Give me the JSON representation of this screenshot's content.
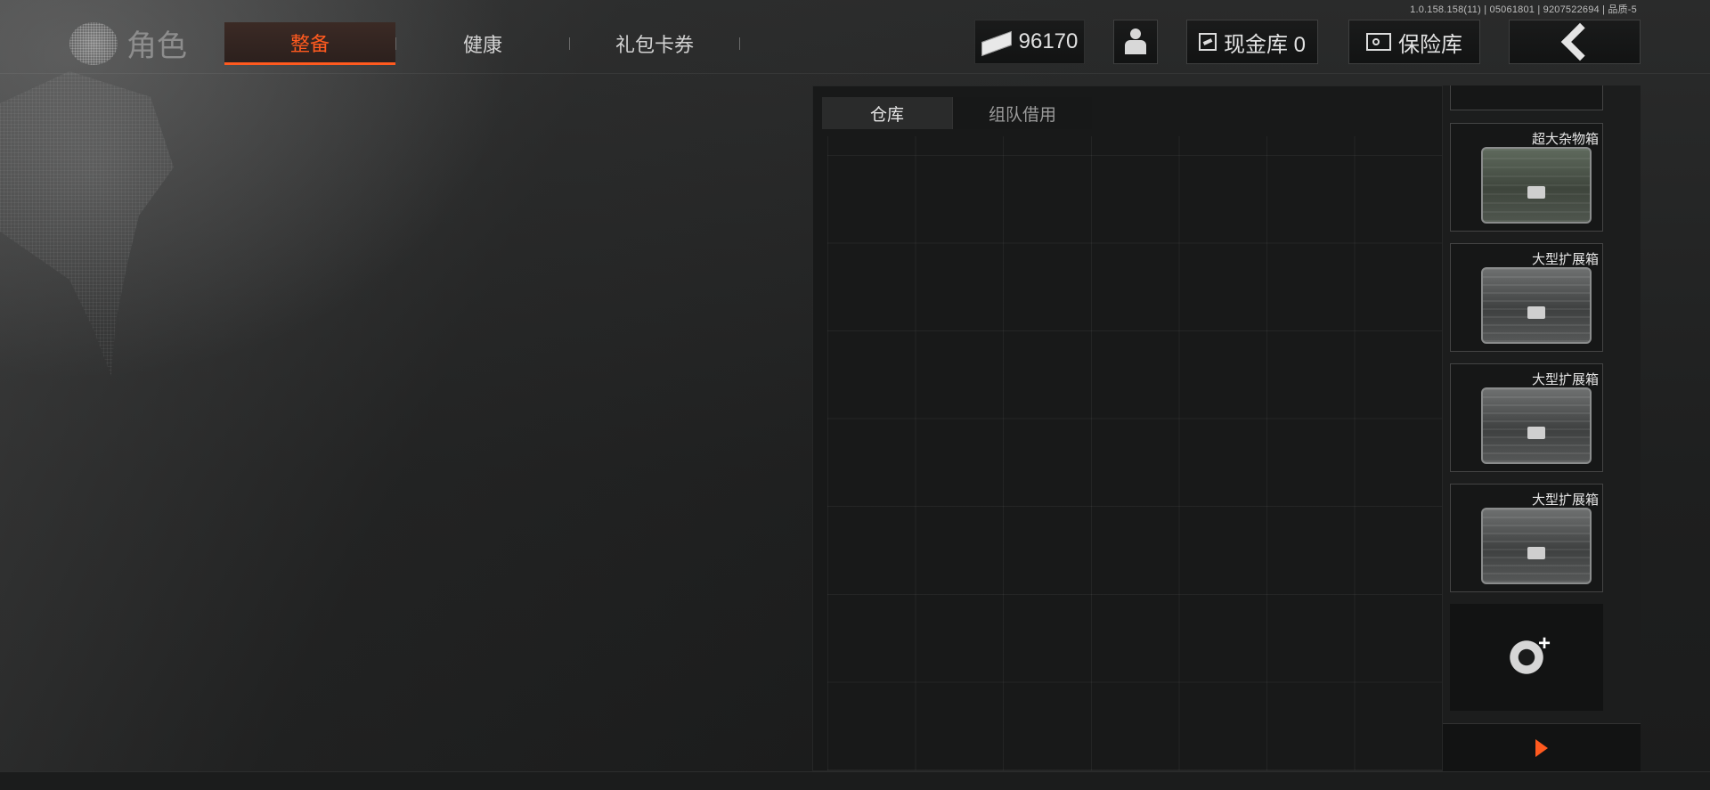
{
  "version": "1.0.158.158(11) | 05061801 | 9207522694 | 品质-5",
  "header": {
    "role_label": "角色",
    "tabs": [
      {
        "label": "整备",
        "active": true
      },
      {
        "label": "健康",
        "active": false
      },
      {
        "label": "礼包卡券",
        "active": false
      }
    ],
    "money": "96170",
    "cash_vault": "现金库 0",
    "vault": "保险库",
    "icons": [
      "money-icon",
      "agent-icon",
      "cash-box-icon",
      "vault-icon",
      "back-chevron-icon"
    ]
  },
  "warehouse": {
    "tabs": [
      {
        "label": "仓库",
        "active": true
      },
      {
        "label": "组队借用",
        "active": false
      }
    ],
    "grid": {
      "columns": 7,
      "rows": 7
    }
  },
  "containers": [
    {
      "name": "超大杂物箱"
    },
    {
      "name": "大型扩展箱"
    },
    {
      "name": "大型扩展箱"
    },
    {
      "name": "大型扩展箱"
    }
  ],
  "colors": {
    "accent": "#ff5a1f",
    "background": "#1f2020",
    "panel": "#181919"
  }
}
